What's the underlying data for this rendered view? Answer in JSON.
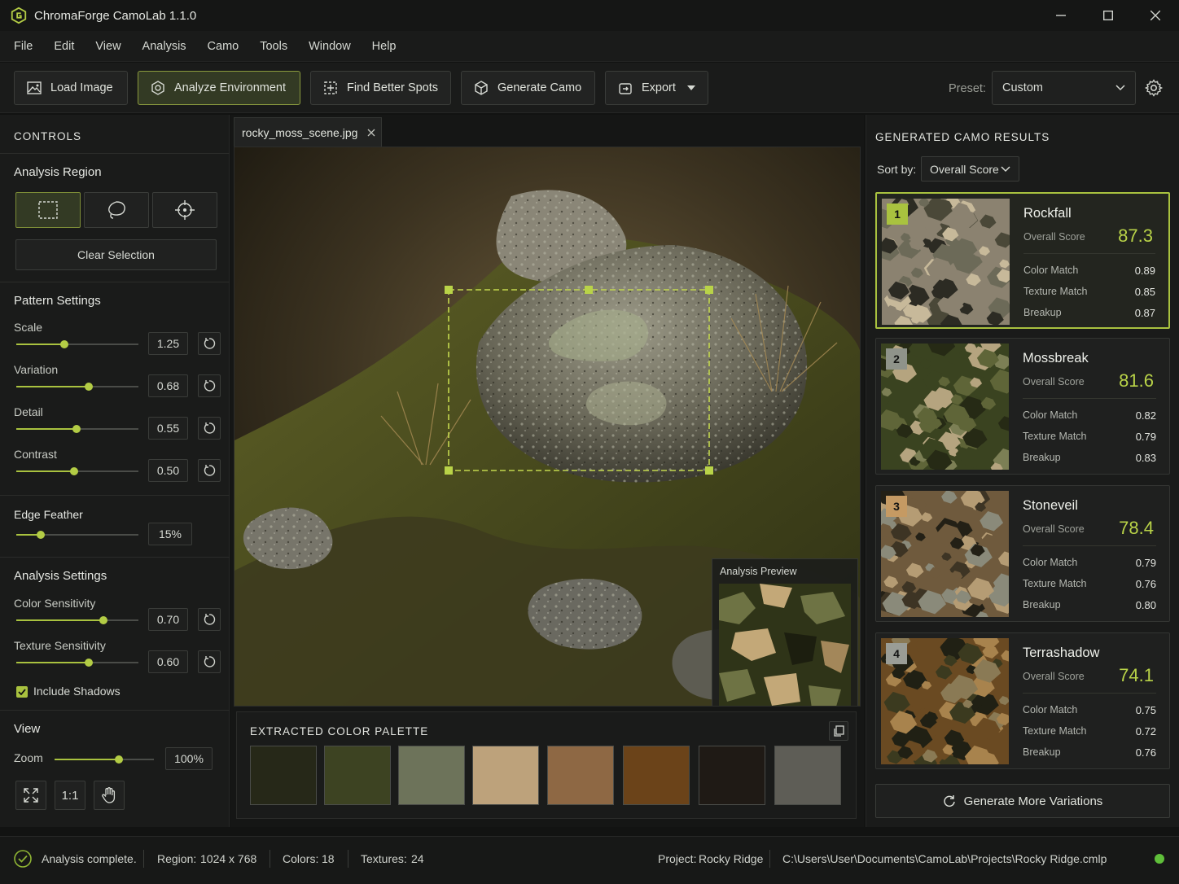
{
  "app": {
    "title": "ChromaForge CamoLab 1.1.0"
  },
  "menu": [
    "File",
    "Edit",
    "View",
    "Analysis",
    "Camo",
    "Tools",
    "Window",
    "Help"
  ],
  "toolbar": {
    "load_image": "Load Image",
    "analyze_environment": "Analyze Environment",
    "find_better_spots": "Find Better Spots",
    "generate_camo": "Generate Camo",
    "export": "Export",
    "preset_label": "Preset:",
    "preset_value": "Custom"
  },
  "controls": {
    "header": "CONTROLS",
    "analysis_region": {
      "title": "Analysis Region",
      "tools": [
        "rectangle-select",
        "lasso-select",
        "point-select"
      ],
      "active_tool": "rectangle-select",
      "clear_selection": "Clear Selection"
    },
    "pattern_settings": {
      "title": "Pattern Settings",
      "sliders": [
        {
          "label": "Scale",
          "value": "1.25",
          "fraction": 0.39
        },
        {
          "label": "Variation",
          "value": "0.68",
          "fraction": 0.59
        },
        {
          "label": "Detail",
          "value": "0.55",
          "fraction": 0.49
        },
        {
          "label": "Contrast",
          "value": "0.50",
          "fraction": 0.47
        }
      ],
      "edge_feather": {
        "label": "Edge Feather",
        "value": "15%",
        "fraction": 0.2
      }
    },
    "analysis_settings": {
      "title": "Analysis Settings",
      "sliders": [
        {
          "label": "Color Sensitivity",
          "value": "0.70",
          "fraction": 0.71
        },
        {
          "label": "Texture Sensitivity",
          "value": "0.60",
          "fraction": 0.59
        }
      ],
      "include_shadows": {
        "label": "Include Shadows",
        "checked": true
      }
    },
    "view": {
      "title": "View",
      "zoom_label": "Zoom",
      "zoom_value": "100%",
      "zoom_fraction": 0.65,
      "fit_label": "1:1"
    }
  },
  "canvas": {
    "tab_name": "rocky_moss_scene.jpg",
    "preview_title": "Analysis Preview"
  },
  "palette": {
    "title": "EXTRACTED COLOR PALETTE",
    "colors": [
      "#262818",
      "#3d4322",
      "#6d735a",
      "#bda27b",
      "#8e6844",
      "#6b4319",
      "#1f1a15",
      "#5e5d56"
    ]
  },
  "results": {
    "header": "GENERATED CAMO RESULTS",
    "sort_label": "Sort by:",
    "sort_value": "Overall Score",
    "overall_label": "Overall Score",
    "metric_labels": [
      "Color Match",
      "Texture Match",
      "Breakup"
    ],
    "items": [
      {
        "rank": "1",
        "name": "Rockfall",
        "score": "87.3",
        "metrics": [
          "0.89",
          "0.85",
          "0.87"
        ],
        "badge": "#a9c23f"
      },
      {
        "rank": "2",
        "name": "Mossbreak",
        "score": "81.6",
        "metrics": [
          "0.82",
          "0.79",
          "0.83"
        ],
        "badge": "#8f938a"
      },
      {
        "rank": "3",
        "name": "Stoneveil",
        "score": "78.4",
        "metrics": [
          "0.79",
          "0.76",
          "0.80"
        ],
        "badge": "#c59a63"
      },
      {
        "rank": "4",
        "name": "Terrashadow",
        "score": "74.1",
        "metrics": [
          "0.75",
          "0.72",
          "0.76"
        ],
        "badge": "#9a9d96"
      }
    ],
    "generate_more": "Generate More Variations"
  },
  "status": {
    "message": "Analysis complete.",
    "region_label": "Region:",
    "region_value": "1024 x 768",
    "colors_label": "Colors:",
    "colors_value": "18",
    "textures_label": "Textures:",
    "textures_value": "24",
    "project_label": "Project:",
    "project_value": "Rocky Ridge",
    "path": "C:\\Users\\User\\Documents\\CamoLab\\Projects\\Rocky Ridge.cmlp"
  },
  "colors": {
    "accent": "#a9c23f",
    "status_ok": "#5fbf3a"
  }
}
